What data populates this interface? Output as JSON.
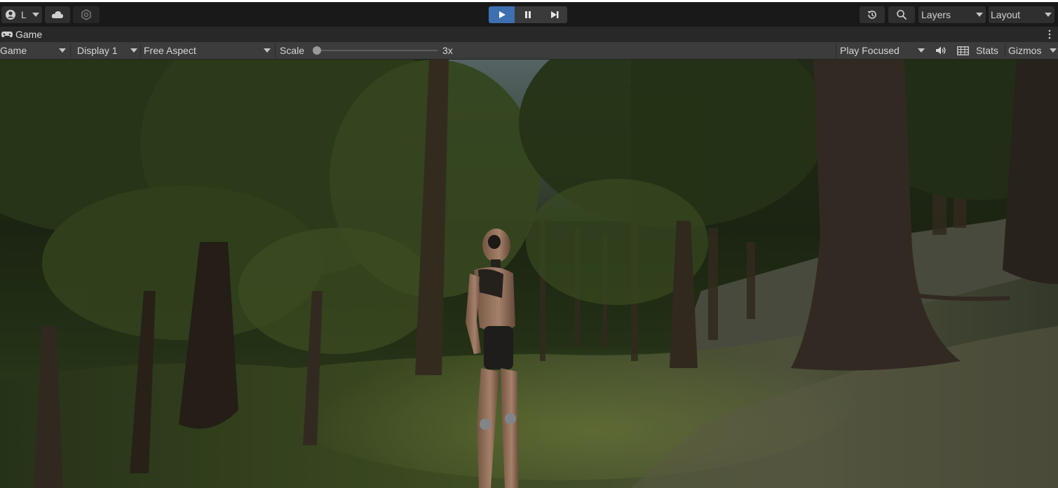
{
  "topbar": {
    "account_initial": "L",
    "layers_label": "Layers",
    "layout_label": "Layout"
  },
  "tab": {
    "title": "Game"
  },
  "toolbar": {
    "mode": "Game",
    "display": "Display 1",
    "aspect": "Free Aspect",
    "scale_label": "Scale",
    "scale_value": "3x",
    "scale_level": 0.0,
    "play_focused": "Play Focused",
    "stats": "Stats",
    "gizmos": "Gizmos"
  },
  "colors": {
    "accent": "#3e6fb0",
    "toolbar_bg": "#3c3c3c",
    "topbar_bg": "#191919"
  },
  "icons": {
    "account": "account-icon",
    "cloud": "cloud-icon",
    "collab": "collab-icon",
    "play": "play-icon",
    "pause": "pause-icon",
    "step": "step-icon",
    "history": "history-icon",
    "search": "search-icon",
    "gamepad": "gamepad-icon",
    "more": "kebab-menu-icon",
    "audio": "speaker-icon",
    "keyboard": "keyboard-icon"
  }
}
